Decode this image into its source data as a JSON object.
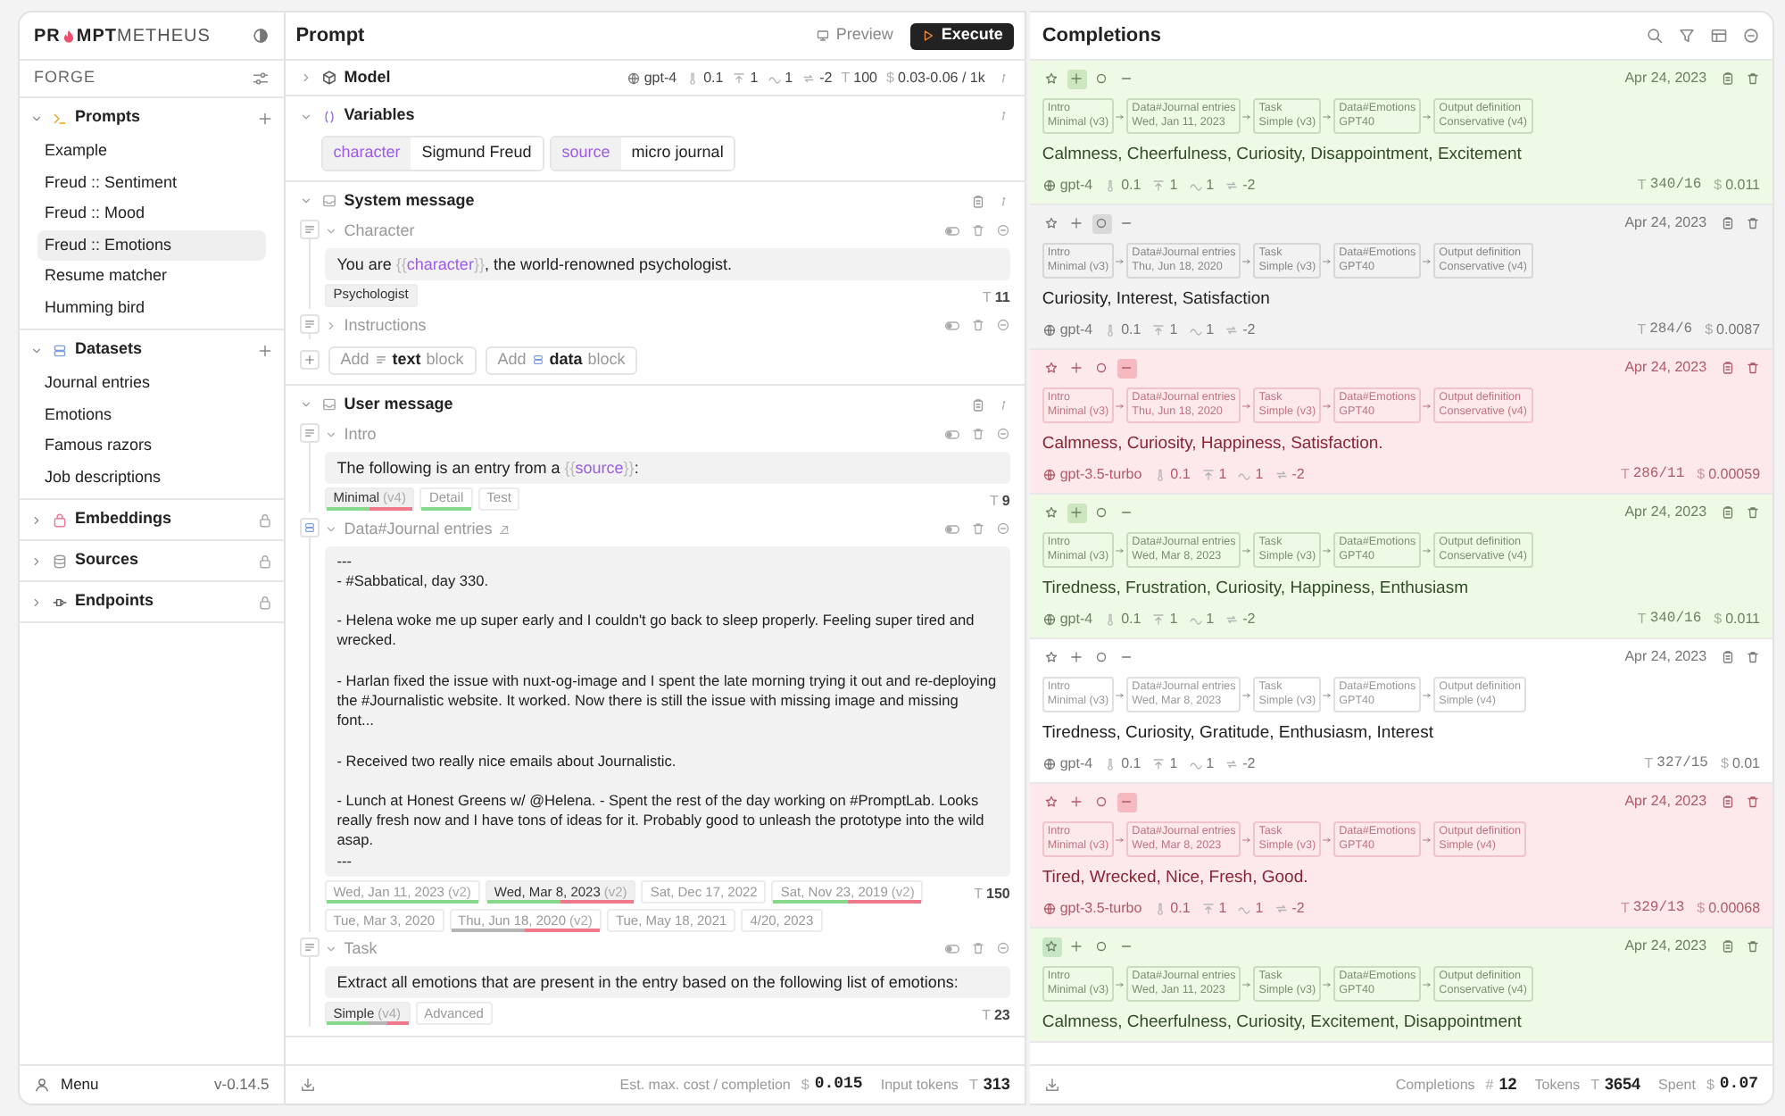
{
  "sidebar": {
    "logo": {
      "part1": "PR",
      "part2": "MPT",
      "part3": "METHEUS"
    },
    "workspace": "FORGE",
    "sections": [
      {
        "kind": "prompts",
        "title": "Prompts",
        "expanded": true,
        "locked": false,
        "items": [
          {
            "label": "Example",
            "selected": false
          },
          {
            "label": "Freud :: Sentiment",
            "selected": false
          },
          {
            "label": "Freud :: Mood",
            "selected": false
          },
          {
            "label": "Freud :: Emotions",
            "selected": true
          },
          {
            "label": "Resume matcher",
            "selected": false
          },
          {
            "label": "Humming bird",
            "selected": false
          }
        ]
      },
      {
        "kind": "datasets",
        "title": "Datasets",
        "expanded": true,
        "locked": false,
        "items": [
          {
            "label": "Journal entries",
            "selected": false
          },
          {
            "label": "Emotions",
            "selected": false
          },
          {
            "label": "Famous razors",
            "selected": false
          },
          {
            "label": "Job descriptions",
            "selected": false
          }
        ]
      },
      {
        "kind": "embeddings",
        "title": "Embeddings",
        "expanded": false,
        "locked": true
      },
      {
        "kind": "sources",
        "title": "Sources",
        "expanded": false,
        "locked": true
      },
      {
        "kind": "endpoints",
        "title": "Endpoints",
        "expanded": false,
        "locked": true
      }
    ],
    "menu": "Menu",
    "version": "v-0.14.5"
  },
  "prompt": {
    "title": "Prompt",
    "preview": "Preview",
    "execute": "Execute",
    "model": {
      "label": "Model",
      "expanded": false,
      "name": "gpt-4",
      "params": [
        {
          "kind": "temperature",
          "value": "0.1"
        },
        {
          "kind": "top_p",
          "value": "1"
        },
        {
          "kind": "frequency",
          "value": "1"
        },
        {
          "kind": "presence",
          "value": "-2"
        },
        {
          "kind": "max_tokens",
          "symbol": "T",
          "value": "100"
        },
        {
          "kind": "cost",
          "symbol": "$",
          "value": "0.03-0.06 / 1k"
        }
      ]
    },
    "variables": {
      "label": "Variables",
      "expanded": true,
      "items": [
        {
          "name": "character",
          "value": "Sigmund Freud"
        },
        {
          "name": "source",
          "value": "micro journal"
        }
      ]
    },
    "sections": [
      {
        "title": "System message",
        "expanded": true,
        "blocks": [
          {
            "kind": "text",
            "title": "Character",
            "expanded": true,
            "parts": [
              {
                "kind": "text",
                "text": "You are "
              },
              {
                "kind": "brace",
                "text": "{{"
              },
              {
                "kind": "var",
                "text": "character"
              },
              {
                "kind": "brace",
                "text": "}}"
              },
              {
                "kind": "text",
                "text": ", the world-renowned psychologist."
              }
            ],
            "tags": [
              {
                "label": "Psychologist",
                "selected": true
              }
            ],
            "tokens_symbol": "T",
            "tokens": "11"
          },
          {
            "kind": "text",
            "title": "Instructions",
            "expanded": false
          }
        ],
        "add_buttons": [
          {
            "kind": "text",
            "prefix": "Add",
            "word": "text",
            "suffix": "block"
          },
          {
            "kind": "data",
            "prefix": "Add",
            "word": "data",
            "suffix": "block"
          }
        ]
      },
      {
        "title": "User message",
        "expanded": true,
        "blocks": [
          {
            "kind": "text",
            "title": "Intro",
            "expanded": true,
            "parts": [
              {
                "kind": "text",
                "text": "The following is an entry from a "
              },
              {
                "kind": "brace",
                "text": "{{"
              },
              {
                "kind": "var",
                "text": "source"
              },
              {
                "kind": "brace",
                "text": "}}"
              },
              {
                "kind": "text",
                "text": ":"
              }
            ],
            "tags": [
              {
                "label": "Minimal",
                "version": "(v4)",
                "selected": true,
                "bar": [
                  {
                    "color": "#86d98a"
                  },
                  {
                    "color": "#f07a8c"
                  }
                ]
              },
              {
                "label": "Detail",
                "selected": false,
                "bar": [
                  {
                    "color": "#86d98a"
                  }
                ]
              },
              {
                "label": "Test",
                "selected": false
              }
            ],
            "tokens_symbol": "T",
            "tokens": "9"
          },
          {
            "kind": "data",
            "title": "Data#Journal entries",
            "expanded": true,
            "parts": [
              {
                "kind": "text",
                "text": "---\n- #Sabbatical, day 330.\n\n- Helena woke me up super early and I couldn't go back to sleep properly. Feeling super tired and wrecked.\n\n- Harlan fixed the issue with nuxt-og-image and I spent the late morning trying it out and re-deploying the #Journalistic website. It worked. Now there is still the issue with missing image and missing font...\n\n- Received two really nice emails about Journalistic.\n\n- Lunch at Honest Greens w/ @Helena. - Spent the rest of the day working on #PromptLab. Looks really fresh now and I have tons of ideas for it. Probably good to unleash the prototype into the wild asap.\n---"
              }
            ],
            "tags": [
              {
                "label": "Wed, Jan 11, 2023",
                "version": "(v2)",
                "selected": false,
                "bar": [
                  {
                    "color": "#86d98a"
                  },
                  {
                    "color": "#86d98a"
                  }
                ]
              },
              {
                "label": "Wed, Mar 8, 2023",
                "version": "(v2)",
                "selected": true,
                "bar": [
                  {
                    "color": "#86d98a"
                  },
                  {
                    "color": "#f07a8c"
                  }
                ]
              },
              {
                "label": "Sat, Dec 17, 2022",
                "selected": false
              },
              {
                "label": "Sat, Nov 23, 2019",
                "version": "(v2)",
                "selected": false,
                "bar": [
                  {
                    "color": "#86d98a"
                  },
                  {
                    "color": "#f07a8c"
                  }
                ]
              },
              {
                "label": "Tue, Mar 3, 2020",
                "selected": false
              },
              {
                "label": "Thu, Jun 18, 2020",
                "version": "(v2)",
                "selected": false,
                "bar": [
                  {
                    "color": "#b5b5b5"
                  },
                  {
                    "color": "#f07a8c"
                  }
                ]
              },
              {
                "label": "Tue, May 18, 2021",
                "selected": false
              },
              {
                "label": "4/20, 2023",
                "selected": false
              }
            ],
            "tokens_symbol": "T",
            "tokens": "150"
          },
          {
            "kind": "text",
            "title": "Task",
            "expanded": true,
            "parts": [
              {
                "kind": "text",
                "text": "Extract all emotions that are present in the entry based on the following list of emotions:"
              }
            ],
            "tags": [
              {
                "label": "Simple",
                "version": "(v4)",
                "selected": true,
                "bar": [
                  {
                    "color": "#86d98a"
                  },
                  {
                    "color": "#86d98a"
                  },
                  {
                    "color": "#b5b5b5"
                  },
                  {
                    "color": "#f07a8c"
                  }
                ]
              },
              {
                "label": "Advanced",
                "selected": false
              }
            ],
            "tokens_symbol": "T",
            "tokens": "23"
          }
        ]
      }
    ],
    "footer": {
      "cost_label": "Est. max. cost / completion",
      "cost_symbol": "$",
      "cost": "0.015",
      "tokens_label": "Input tokens",
      "tokens_symbol": "T",
      "tokens": "313"
    }
  },
  "completions": {
    "title": "Completions",
    "items": [
      {
        "buttons": [
          {
            "kind": "star",
            "selected": false
          },
          {
            "kind": "plus",
            "selected": true
          },
          {
            "kind": "circle",
            "selected": false
          },
          {
            "kind": "minus",
            "selected": false
          }
        ],
        "date": "Apr 24, 2023",
        "chips": [
          {
            "label": "Intro",
            "value": "Minimal (v3)"
          },
          {
            "label": "Data#Journal entries",
            "value": "Wed, Jan 11, 2023"
          },
          {
            "label": "Task",
            "value": "Simple (v3)"
          },
          {
            "label": "Data#Emotions",
            "value": "GPT40"
          },
          {
            "label": "Output definition",
            "value": "Conservative (v4)"
          }
        ],
        "text": "Calmness, Cheerfulness, Curiosity, Disappointment, Excitement",
        "tokens_symbol": "T",
        "cost_symbol": "$",
        "model": "gpt-4",
        "params": [
          {
            "kind": "temperature",
            "value": "0.1"
          },
          {
            "kind": "top_p",
            "value": "1"
          },
          {
            "kind": "frequency",
            "value": "1"
          },
          {
            "kind": "presence",
            "value": "-2"
          }
        ],
        "tokens": "340/16",
        "cost": "0.011"
      },
      {
        "buttons": [
          {
            "kind": "star",
            "selected": false
          },
          {
            "kind": "plus",
            "selected": false
          },
          {
            "kind": "circle",
            "selected": true
          },
          {
            "kind": "minus",
            "selected": false
          }
        ],
        "date": "Apr 24, 2023",
        "chips": [
          {
            "label": "Intro",
            "value": "Minimal (v3)"
          },
          {
            "label": "Data#Journal entries",
            "value": "Thu, Jun 18, 2020"
          },
          {
            "label": "Task",
            "value": "Simple (v3)"
          },
          {
            "label": "Data#Emotions",
            "value": "GPT40"
          },
          {
            "label": "Output definition",
            "value": "Conservative (v4)"
          }
        ],
        "text": "Curiosity, Interest, Satisfaction",
        "tokens_symbol": "T",
        "cost_symbol": "$",
        "model": "gpt-4",
        "params": [
          {
            "kind": "temperature",
            "value": "0.1"
          },
          {
            "kind": "top_p",
            "value": "1"
          },
          {
            "kind": "frequency",
            "value": "1"
          },
          {
            "kind": "presence",
            "value": "-2"
          }
        ],
        "tokens": "284/6",
        "cost": "0.0087"
      },
      {
        "buttons": [
          {
            "kind": "star",
            "selected": false
          },
          {
            "kind": "plus",
            "selected": false
          },
          {
            "kind": "circle",
            "selected": false
          },
          {
            "kind": "minus",
            "selected": true
          }
        ],
        "date": "Apr 24, 2023",
        "chips": [
          {
            "label": "Intro",
            "value": "Minimal (v3)"
          },
          {
            "label": "Data#Journal entries",
            "value": "Thu, Jun 18, 2020"
          },
          {
            "label": "Task",
            "value": "Simple (v3)"
          },
          {
            "label": "Data#Emotions",
            "value": "GPT40"
          },
          {
            "label": "Output definition",
            "value": "Conservative (v4)"
          }
        ],
        "text": "Calmness, Curiosity, Happiness, Satisfaction.",
        "tokens_symbol": "T",
        "cost_symbol": "$",
        "model": "gpt-3.5-turbo",
        "params": [
          {
            "kind": "temperature",
            "value": "0.1"
          },
          {
            "kind": "top_p",
            "value": "1"
          },
          {
            "kind": "frequency",
            "value": "1"
          },
          {
            "kind": "presence",
            "value": "-2"
          }
        ],
        "tokens": "286/11",
        "cost": "0.00059"
      },
      {
        "buttons": [
          {
            "kind": "star",
            "selected": false
          },
          {
            "kind": "plus",
            "selected": true
          },
          {
            "kind": "circle",
            "selected": false
          },
          {
            "kind": "minus",
            "selected": false
          }
        ],
        "date": "Apr 24, 2023",
        "chips": [
          {
            "label": "Intro",
            "value": "Minimal (v3)"
          },
          {
            "label": "Data#Journal entries",
            "value": "Wed, Mar 8, 2023"
          },
          {
            "label": "Task",
            "value": "Simple (v3)"
          },
          {
            "label": "Data#Emotions",
            "value": "GPT40"
          },
          {
            "label": "Output definition",
            "value": "Conservative (v4)"
          }
        ],
        "text": "Tiredness, Frustration, Curiosity, Happiness, Enthusiasm",
        "tokens_symbol": "T",
        "cost_symbol": "$",
        "model": "gpt-4",
        "params": [
          {
            "kind": "temperature",
            "value": "0.1"
          },
          {
            "kind": "top_p",
            "value": "1"
          },
          {
            "kind": "frequency",
            "value": "1"
          },
          {
            "kind": "presence",
            "value": "-2"
          }
        ],
        "tokens": "340/16",
        "cost": "0.011"
      },
      {
        "buttons": [
          {
            "kind": "star",
            "selected": false
          },
          {
            "kind": "plus",
            "selected": false
          },
          {
            "kind": "circle",
            "selected": false
          },
          {
            "kind": "minus",
            "selected": false
          }
        ],
        "date": "Apr 24, 2023",
        "chips": [
          {
            "label": "Intro",
            "value": "Minimal (v3)"
          },
          {
            "label": "Data#Journal entries",
            "value": "Wed, Mar 8, 2023"
          },
          {
            "label": "Task",
            "value": "Simple (v3)"
          },
          {
            "label": "Data#Emotions",
            "value": "GPT40"
          },
          {
            "label": "Output definition",
            "value": "Simple (v4)"
          }
        ],
        "text": "Tiredness, Curiosity, Gratitude, Enthusiasm, Interest",
        "tokens_symbol": "T",
        "cost_symbol": "$",
        "model": "gpt-4",
        "params": [
          {
            "kind": "temperature",
            "value": "0.1"
          },
          {
            "kind": "top_p",
            "value": "1"
          },
          {
            "kind": "frequency",
            "value": "1"
          },
          {
            "kind": "presence",
            "value": "-2"
          }
        ],
        "tokens": "327/15",
        "cost": "0.01"
      },
      {
        "buttons": [
          {
            "kind": "star",
            "selected": false
          },
          {
            "kind": "plus",
            "selected": false
          },
          {
            "kind": "circle",
            "selected": false
          },
          {
            "kind": "minus",
            "selected": true
          }
        ],
        "date": "Apr 24, 2023",
        "chips": [
          {
            "label": "Intro",
            "value": "Minimal (v3)"
          },
          {
            "label": "Data#Journal entries",
            "value": "Wed, Mar 8, 2023"
          },
          {
            "label": "Task",
            "value": "Simple (v3)"
          },
          {
            "label": "Data#Emotions",
            "value": "GPT40"
          },
          {
            "label": "Output definition",
            "value": "Simple (v4)"
          }
        ],
        "text": "Tired, Wrecked, Nice, Fresh, Good.",
        "tokens_symbol": "T",
        "cost_symbol": "$",
        "model": "gpt-3.5-turbo",
        "params": [
          {
            "kind": "temperature",
            "value": "0.1"
          },
          {
            "kind": "top_p",
            "value": "1"
          },
          {
            "kind": "frequency",
            "value": "1"
          },
          {
            "kind": "presence",
            "value": "-2"
          }
        ],
        "tokens": "329/13",
        "cost": "0.00068"
      },
      {
        "buttons": [
          {
            "kind": "star",
            "selected": true
          },
          {
            "kind": "plus",
            "selected": false
          },
          {
            "kind": "circle",
            "selected": false
          },
          {
            "kind": "minus",
            "selected": false
          }
        ],
        "date": "Apr 24, 2023",
        "chips": [
          {
            "label": "Intro",
            "value": "Minimal (v3)"
          },
          {
            "label": "Data#Journal entries",
            "value": "Wed, Jan 11, 2023"
          },
          {
            "label": "Task",
            "value": "Simple (v3)"
          },
          {
            "label": "Data#Emotions",
            "value": "GPT40"
          },
          {
            "label": "Output definition",
            "value": "Conservative (v4)"
          }
        ],
        "text": "Calmness, Cheerfulness, Curiosity, Excitement, Disappointment"
      }
    ],
    "footer": {
      "count_label": "Completions",
      "count_symbol": "#",
      "count": "12",
      "tokens_label": "Tokens",
      "tokens_symbol": "T",
      "tokens": "3654",
      "spent_label": "Spent",
      "spent_symbol": "$",
      "spent": "0.07"
    }
  }
}
